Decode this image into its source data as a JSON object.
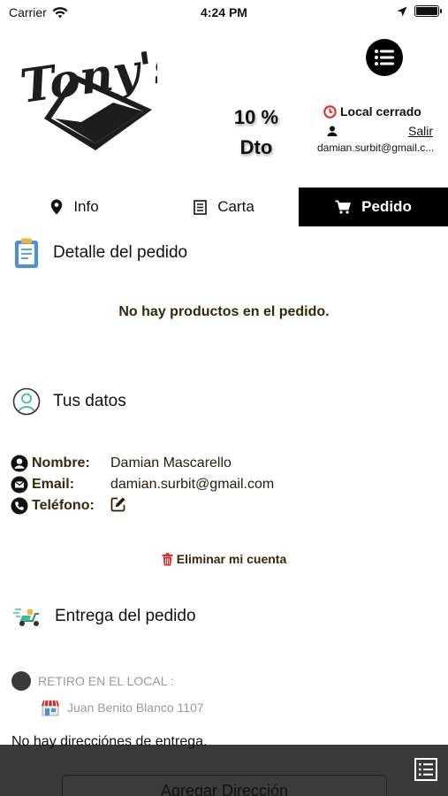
{
  "status_bar": {
    "carrier": "Carrier",
    "time": "4:24 PM"
  },
  "header": {
    "discount_value": "10 %",
    "discount_label": "Dto",
    "local_status": "Local cerrado",
    "logout_label": "Salir",
    "user_email_short": "damian.surbit@gmail.c..."
  },
  "tabs": [
    {
      "label": "Info",
      "icon": "map-pin-icon"
    },
    {
      "label": "Carta",
      "icon": "menu-book-icon"
    },
    {
      "label": "Pedido",
      "icon": "cart-icon",
      "active": true
    }
  ],
  "order": {
    "title": "Detalle del pedido",
    "empty_message": "No hay productos en el pedido."
  },
  "user_data": {
    "title": "Tus datos",
    "name_label": "Nombre:",
    "name_value": "Damian Mascarello",
    "email_label": "Email:",
    "email_value": "damian.surbit@gmail.com",
    "phone_label": "Teléfono:"
  },
  "delete_account_label": "Eliminar mi cuenta",
  "delivery": {
    "title": "Entrega del pedido",
    "pickup_label": "RETIRO EN EL LOCAL :",
    "pickup_address": "Juan Benito Blanco 1107",
    "no_addresses": "No hay direcciónes de entrega.",
    "add_address_label": "Agregar Dirección"
  },
  "colors": {
    "accent_dark": "#3a2608",
    "closed_red": "#e0281f",
    "active_tab": "#000000"
  }
}
